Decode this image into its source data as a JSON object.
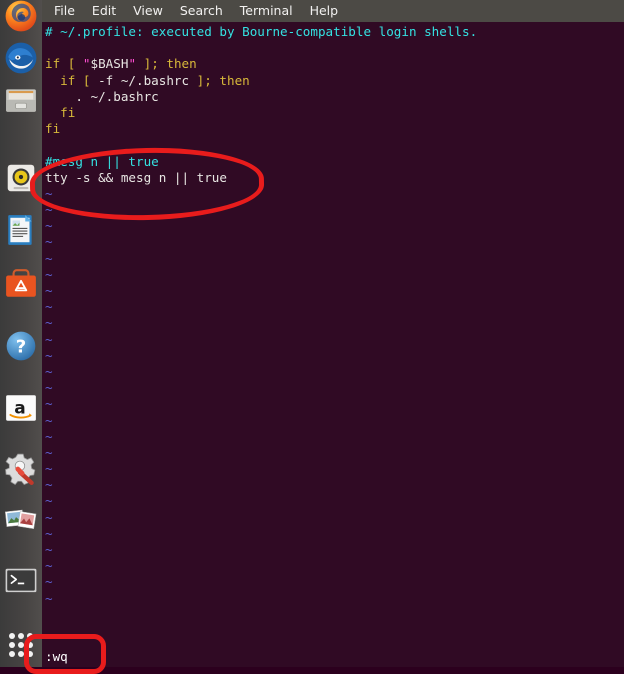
{
  "window": {
    "app": "terminal",
    "colors": {
      "terminal_background": "#300a24",
      "menubar_background": "#4c4a45",
      "launcher_background": "#474443",
      "annotation_red": "#e81c1c",
      "comment_cyan": "#34e2e2",
      "keyword_yellow": "#d8b93a",
      "string_magenta": "#ff4dd2",
      "tilde_blue": "#5c5fd0",
      "foreground": "#e8e6e3"
    }
  },
  "menubar": {
    "items": [
      {
        "label": "File",
        "name": "menu-file"
      },
      {
        "label": "Edit",
        "name": "menu-edit"
      },
      {
        "label": "View",
        "name": "menu-view"
      },
      {
        "label": "Search",
        "name": "menu-search"
      },
      {
        "label": "Terminal",
        "name": "menu-terminal"
      },
      {
        "label": "Help",
        "name": "menu-help"
      }
    ]
  },
  "launcher": {
    "items": [
      {
        "name": "firefox-icon",
        "label": "Firefox"
      },
      {
        "name": "thunderbird-icon",
        "label": "Thunderbird Mail"
      },
      {
        "name": "files-icon",
        "label": "Files"
      },
      {
        "name": "rhythmbox-icon",
        "label": "Rhythmbox"
      },
      {
        "name": "libreoffice-writer-icon",
        "label": "LibreOffice Writer"
      },
      {
        "name": "ubuntu-software-icon",
        "label": "Ubuntu Software"
      },
      {
        "name": "help-icon",
        "label": "Ubuntu Help"
      },
      {
        "name": "amazon-icon",
        "label": "Amazon"
      },
      {
        "name": "system-settings-icon",
        "label": "System Settings"
      },
      {
        "name": "shotwell-icon",
        "label": "Photos"
      },
      {
        "name": "terminal-icon",
        "label": "Terminal"
      }
    ],
    "show_applications": {
      "name": "show-applications-button",
      "label": "Show Applications"
    }
  },
  "editor": {
    "lines": [
      {
        "type": "code",
        "segments": [
          {
            "cls": "c-comment",
            "text": "# ~/.profile: executed by Bourne-compatible login shells."
          }
        ]
      },
      {
        "type": "code",
        "segments": [
          {
            "cls": "c-plain",
            "text": ""
          }
        ]
      },
      {
        "type": "code",
        "segments": [
          {
            "cls": "c-kw",
            "text": "if [ "
          },
          {
            "cls": "c-str",
            "text": "\""
          },
          {
            "cls": "c-plain",
            "text": "$BASH"
          },
          {
            "cls": "c-str",
            "text": "\""
          },
          {
            "cls": "c-kw",
            "text": " ]; then"
          }
        ]
      },
      {
        "type": "code",
        "segments": [
          {
            "cls": "c-kw",
            "text": "  if [ "
          },
          {
            "cls": "c-plain",
            "text": "-f ~/.bashrc"
          },
          {
            "cls": "c-kw",
            "text": " ]; then"
          }
        ]
      },
      {
        "type": "code",
        "segments": [
          {
            "cls": "c-plain",
            "text": "    . ~/.bashrc"
          }
        ]
      },
      {
        "type": "code",
        "segments": [
          {
            "cls": "c-kw",
            "text": "  fi"
          }
        ]
      },
      {
        "type": "code",
        "segments": [
          {
            "cls": "c-kw",
            "text": "fi"
          }
        ]
      },
      {
        "type": "code",
        "segments": [
          {
            "cls": "c-plain",
            "text": ""
          }
        ]
      },
      {
        "type": "code",
        "segments": [
          {
            "cls": "c-comment",
            "text": "#mesg n || true"
          }
        ]
      },
      {
        "type": "code",
        "segments": [
          {
            "cls": "c-plain",
            "text": "tty -s && mesg n || true"
          }
        ]
      },
      {
        "type": "tilde"
      },
      {
        "type": "tilde"
      },
      {
        "type": "tilde"
      },
      {
        "type": "tilde"
      },
      {
        "type": "tilde"
      },
      {
        "type": "tilde"
      },
      {
        "type": "tilde"
      },
      {
        "type": "tilde"
      },
      {
        "type": "tilde"
      },
      {
        "type": "tilde"
      },
      {
        "type": "tilde"
      },
      {
        "type": "tilde"
      },
      {
        "type": "tilde"
      },
      {
        "type": "tilde"
      },
      {
        "type": "tilde"
      },
      {
        "type": "tilde"
      },
      {
        "type": "tilde"
      },
      {
        "type": "tilde"
      },
      {
        "type": "tilde"
      },
      {
        "type": "tilde"
      },
      {
        "type": "tilde"
      },
      {
        "type": "tilde"
      },
      {
        "type": "tilde"
      },
      {
        "type": "tilde"
      },
      {
        "type": "tilde"
      },
      {
        "type": "tilde"
      }
    ],
    "tilde_char": "~",
    "statusline": ":wq"
  },
  "annotations": [
    {
      "name": "annotation-ellipse-mesg-lines",
      "shape": "ellipse",
      "color": "#e81c1c"
    },
    {
      "name": "annotation-rect-wq-command",
      "shape": "rounded-rect",
      "color": "#e81c1c"
    }
  ]
}
